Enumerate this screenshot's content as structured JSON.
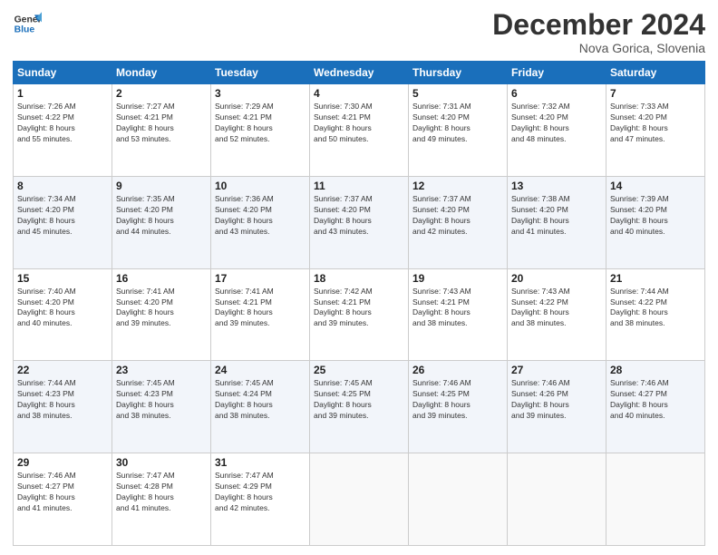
{
  "header": {
    "logo_line1": "General",
    "logo_line2": "Blue",
    "month_year": "December 2024",
    "location": "Nova Gorica, Slovenia"
  },
  "weekdays": [
    "Sunday",
    "Monday",
    "Tuesday",
    "Wednesday",
    "Thursday",
    "Friday",
    "Saturday"
  ],
  "weeks": [
    [
      {
        "day": "1",
        "sunrise": "7:26 AM",
        "sunset": "4:22 PM",
        "daylight": "8 hours and 55 minutes."
      },
      {
        "day": "2",
        "sunrise": "7:27 AM",
        "sunset": "4:21 PM",
        "daylight": "8 hours and 53 minutes."
      },
      {
        "day": "3",
        "sunrise": "7:29 AM",
        "sunset": "4:21 PM",
        "daylight": "8 hours and 52 minutes."
      },
      {
        "day": "4",
        "sunrise": "7:30 AM",
        "sunset": "4:21 PM",
        "daylight": "8 hours and 50 minutes."
      },
      {
        "day": "5",
        "sunrise": "7:31 AM",
        "sunset": "4:20 PM",
        "daylight": "8 hours and 49 minutes."
      },
      {
        "day": "6",
        "sunrise": "7:32 AM",
        "sunset": "4:20 PM",
        "daylight": "8 hours and 48 minutes."
      },
      {
        "day": "7",
        "sunrise": "7:33 AM",
        "sunset": "4:20 PM",
        "daylight": "8 hours and 47 minutes."
      }
    ],
    [
      {
        "day": "8",
        "sunrise": "7:34 AM",
        "sunset": "4:20 PM",
        "daylight": "8 hours and 45 minutes."
      },
      {
        "day": "9",
        "sunrise": "7:35 AM",
        "sunset": "4:20 PM",
        "daylight": "8 hours and 44 minutes."
      },
      {
        "day": "10",
        "sunrise": "7:36 AM",
        "sunset": "4:20 PM",
        "daylight": "8 hours and 43 minutes."
      },
      {
        "day": "11",
        "sunrise": "7:37 AM",
        "sunset": "4:20 PM",
        "daylight": "8 hours and 43 minutes."
      },
      {
        "day": "12",
        "sunrise": "7:37 AM",
        "sunset": "4:20 PM",
        "daylight": "8 hours and 42 minutes."
      },
      {
        "day": "13",
        "sunrise": "7:38 AM",
        "sunset": "4:20 PM",
        "daylight": "8 hours and 41 minutes."
      },
      {
        "day": "14",
        "sunrise": "7:39 AM",
        "sunset": "4:20 PM",
        "daylight": "8 hours and 40 minutes."
      }
    ],
    [
      {
        "day": "15",
        "sunrise": "7:40 AM",
        "sunset": "4:20 PM",
        "daylight": "8 hours and 40 minutes."
      },
      {
        "day": "16",
        "sunrise": "7:41 AM",
        "sunset": "4:20 PM",
        "daylight": "8 hours and 39 minutes."
      },
      {
        "day": "17",
        "sunrise": "7:41 AM",
        "sunset": "4:21 PM",
        "daylight": "8 hours and 39 minutes."
      },
      {
        "day": "18",
        "sunrise": "7:42 AM",
        "sunset": "4:21 PM",
        "daylight": "8 hours and 39 minutes."
      },
      {
        "day": "19",
        "sunrise": "7:43 AM",
        "sunset": "4:21 PM",
        "daylight": "8 hours and 38 minutes."
      },
      {
        "day": "20",
        "sunrise": "7:43 AM",
        "sunset": "4:22 PM",
        "daylight": "8 hours and 38 minutes."
      },
      {
        "day": "21",
        "sunrise": "7:44 AM",
        "sunset": "4:22 PM",
        "daylight": "8 hours and 38 minutes."
      }
    ],
    [
      {
        "day": "22",
        "sunrise": "7:44 AM",
        "sunset": "4:23 PM",
        "daylight": "8 hours and 38 minutes."
      },
      {
        "day": "23",
        "sunrise": "7:45 AM",
        "sunset": "4:23 PM",
        "daylight": "8 hours and 38 minutes."
      },
      {
        "day": "24",
        "sunrise": "7:45 AM",
        "sunset": "4:24 PM",
        "daylight": "8 hours and 38 minutes."
      },
      {
        "day": "25",
        "sunrise": "7:45 AM",
        "sunset": "4:25 PM",
        "daylight": "8 hours and 39 minutes."
      },
      {
        "day": "26",
        "sunrise": "7:46 AM",
        "sunset": "4:25 PM",
        "daylight": "8 hours and 39 minutes."
      },
      {
        "day": "27",
        "sunrise": "7:46 AM",
        "sunset": "4:26 PM",
        "daylight": "8 hours and 39 minutes."
      },
      {
        "day": "28",
        "sunrise": "7:46 AM",
        "sunset": "4:27 PM",
        "daylight": "8 hours and 40 minutes."
      }
    ],
    [
      {
        "day": "29",
        "sunrise": "7:46 AM",
        "sunset": "4:27 PM",
        "daylight": "8 hours and 41 minutes."
      },
      {
        "day": "30",
        "sunrise": "7:47 AM",
        "sunset": "4:28 PM",
        "daylight": "8 hours and 41 minutes."
      },
      {
        "day": "31",
        "sunrise": "7:47 AM",
        "sunset": "4:29 PM",
        "daylight": "8 hours and 42 minutes."
      },
      null,
      null,
      null,
      null
    ]
  ],
  "labels": {
    "sunrise": "Sunrise:",
    "sunset": "Sunset:",
    "daylight": "Daylight:"
  }
}
